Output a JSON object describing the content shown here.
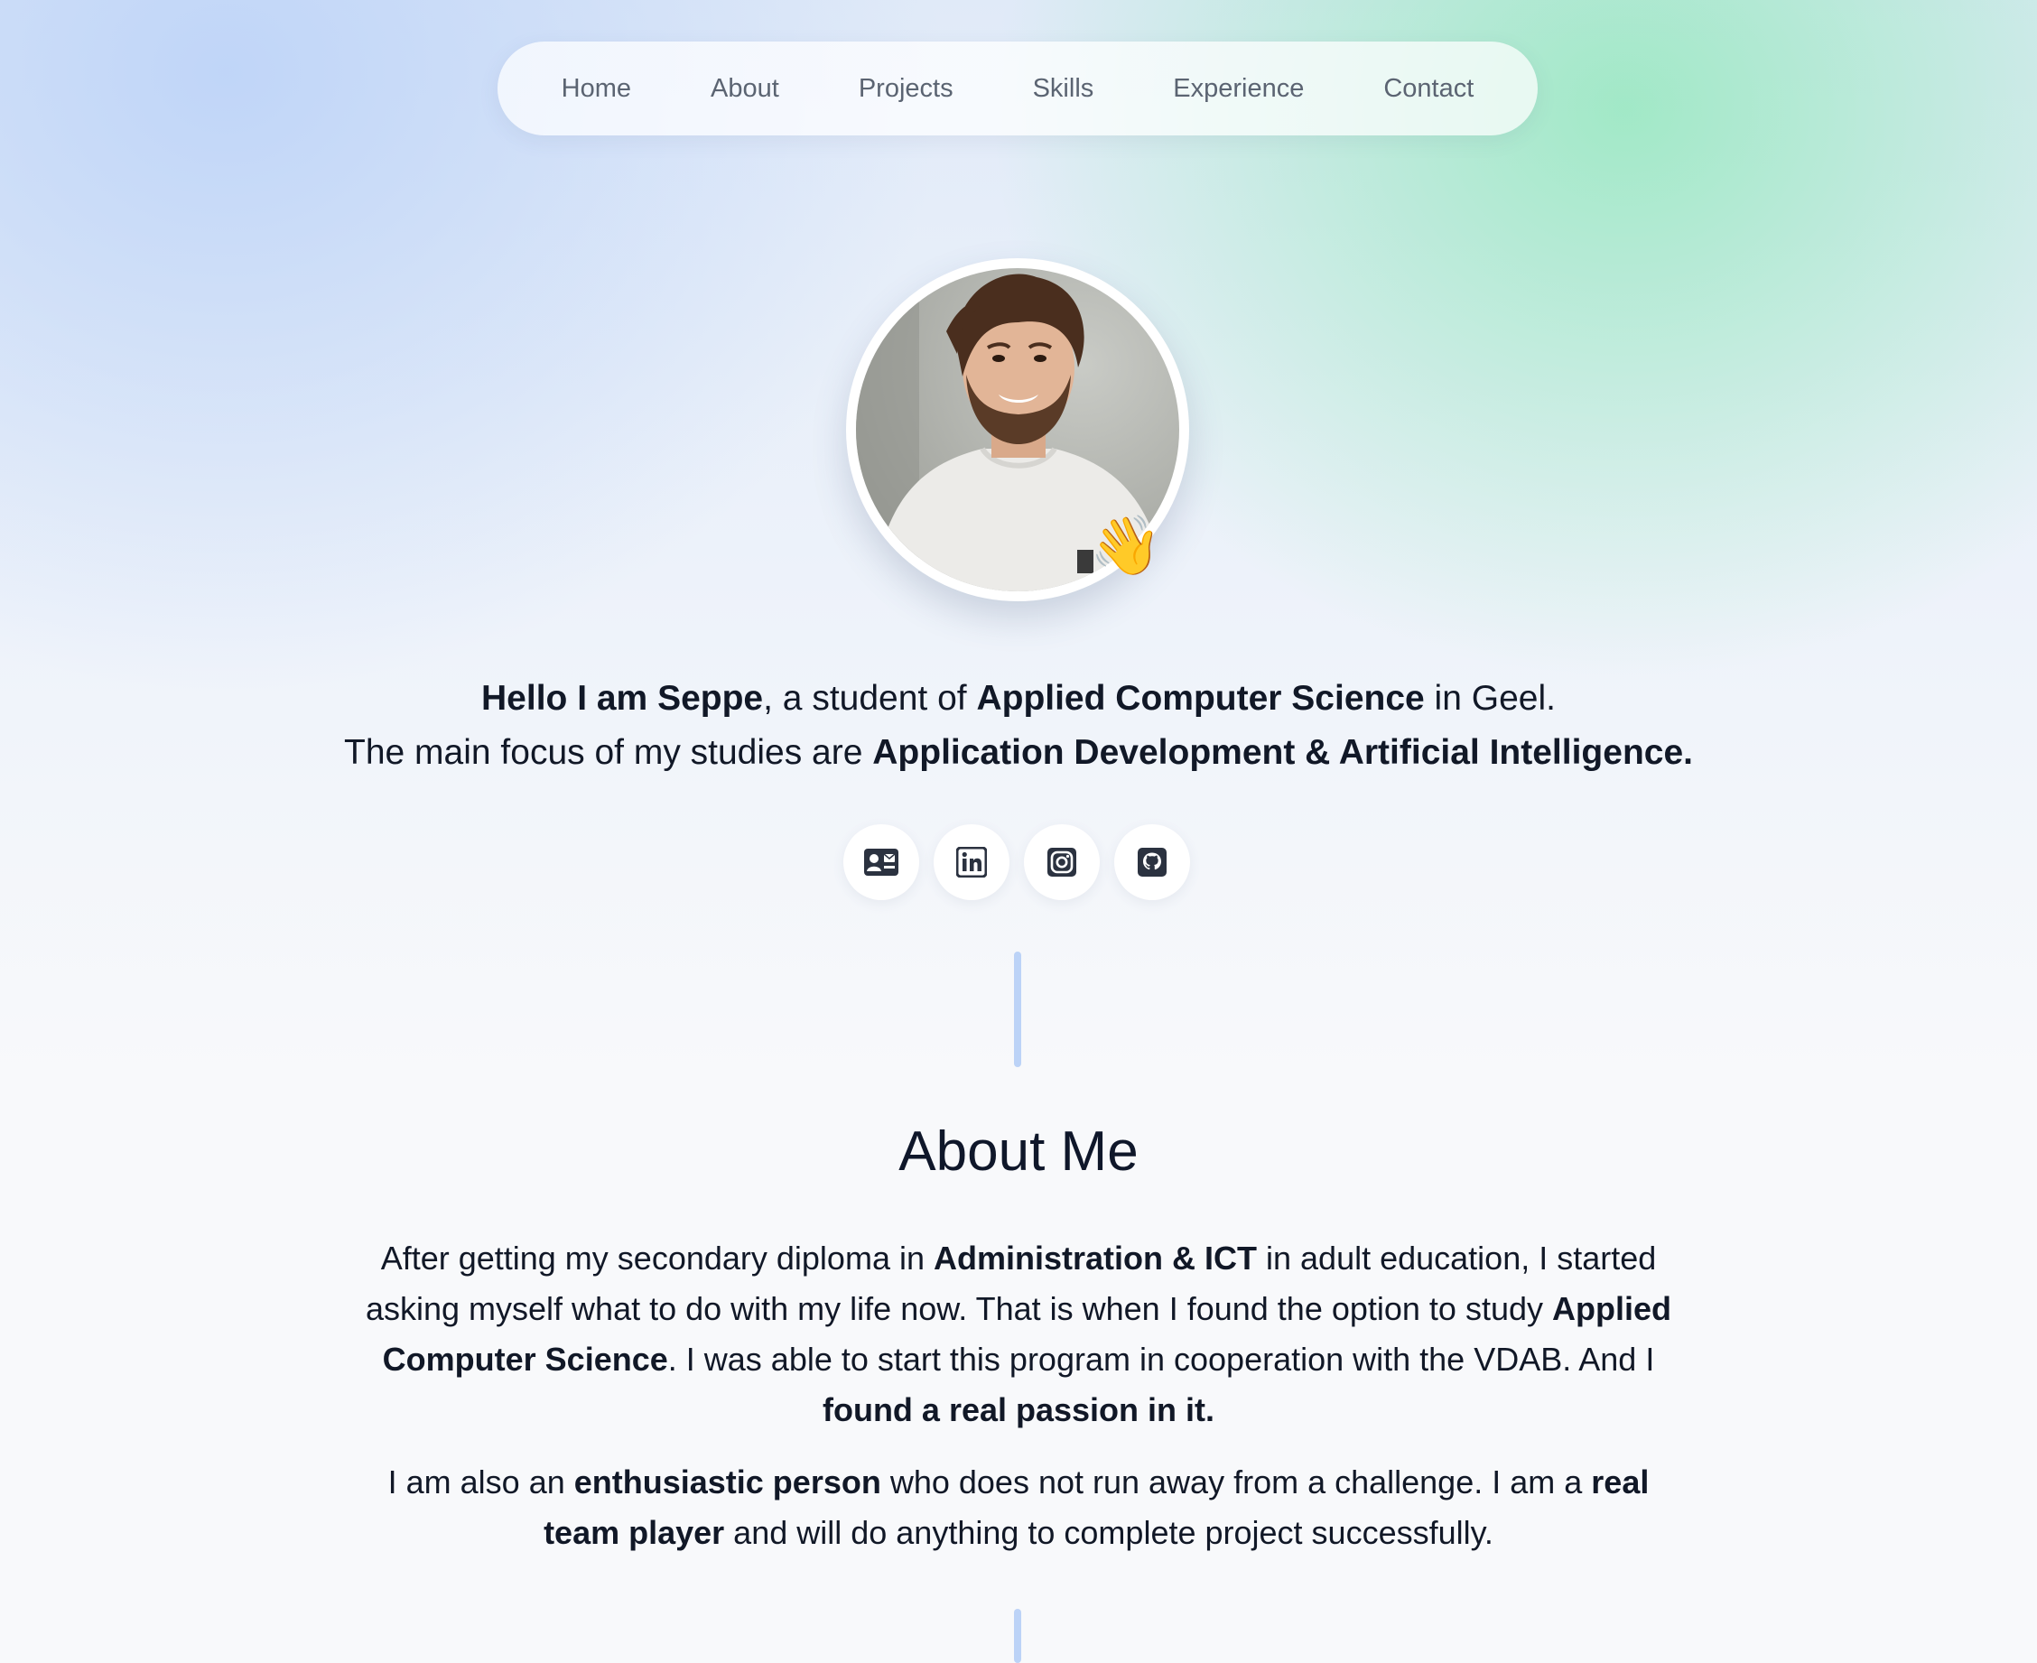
{
  "nav": {
    "items": [
      "Home",
      "About",
      "Projects",
      "Skills",
      "Experience",
      "Contact"
    ]
  },
  "hero": {
    "avatar_alt": "Profile photo",
    "wave_emoji": "👋",
    "line1": {
      "b1": "Hello I am Seppe",
      "t1": ", a student of ",
      "b2": "Applied Computer Science",
      "t2": " in Geel."
    },
    "line2": {
      "t1": "The main focus of my studies are ",
      "b1": "Application Development & Artificial Intelligence."
    },
    "social": [
      {
        "icon": "contact-card-icon"
      },
      {
        "icon": "linkedin-icon"
      },
      {
        "icon": "instagram-icon"
      },
      {
        "icon": "github-icon"
      }
    ]
  },
  "about": {
    "title": "About Me",
    "p1": {
      "t1": "After getting my secondary diploma in ",
      "b1": "Administration & ICT",
      "t2": " in adult education, I started asking myself what to do with my life now. That is when I found the option to study ",
      "b2": "Applied Computer Science",
      "t3": ". I was able to start this program in cooperation with the VDAB. And I ",
      "b3": "found a real passion in it."
    },
    "p2": {
      "t1": "I am also an ",
      "b1": "enthusiastic person",
      "t2": " who does not run away from a challenge. I am a ",
      "b2": "real team player",
      "t3": " and will do anything to complete project successfully."
    }
  },
  "colors": {
    "accent_divider": "#bcd3f7",
    "nav_text": "#5b6472",
    "text": "#111827",
    "bg_blue": "#c9dcf8",
    "bg_green": "#b5ecd2"
  }
}
